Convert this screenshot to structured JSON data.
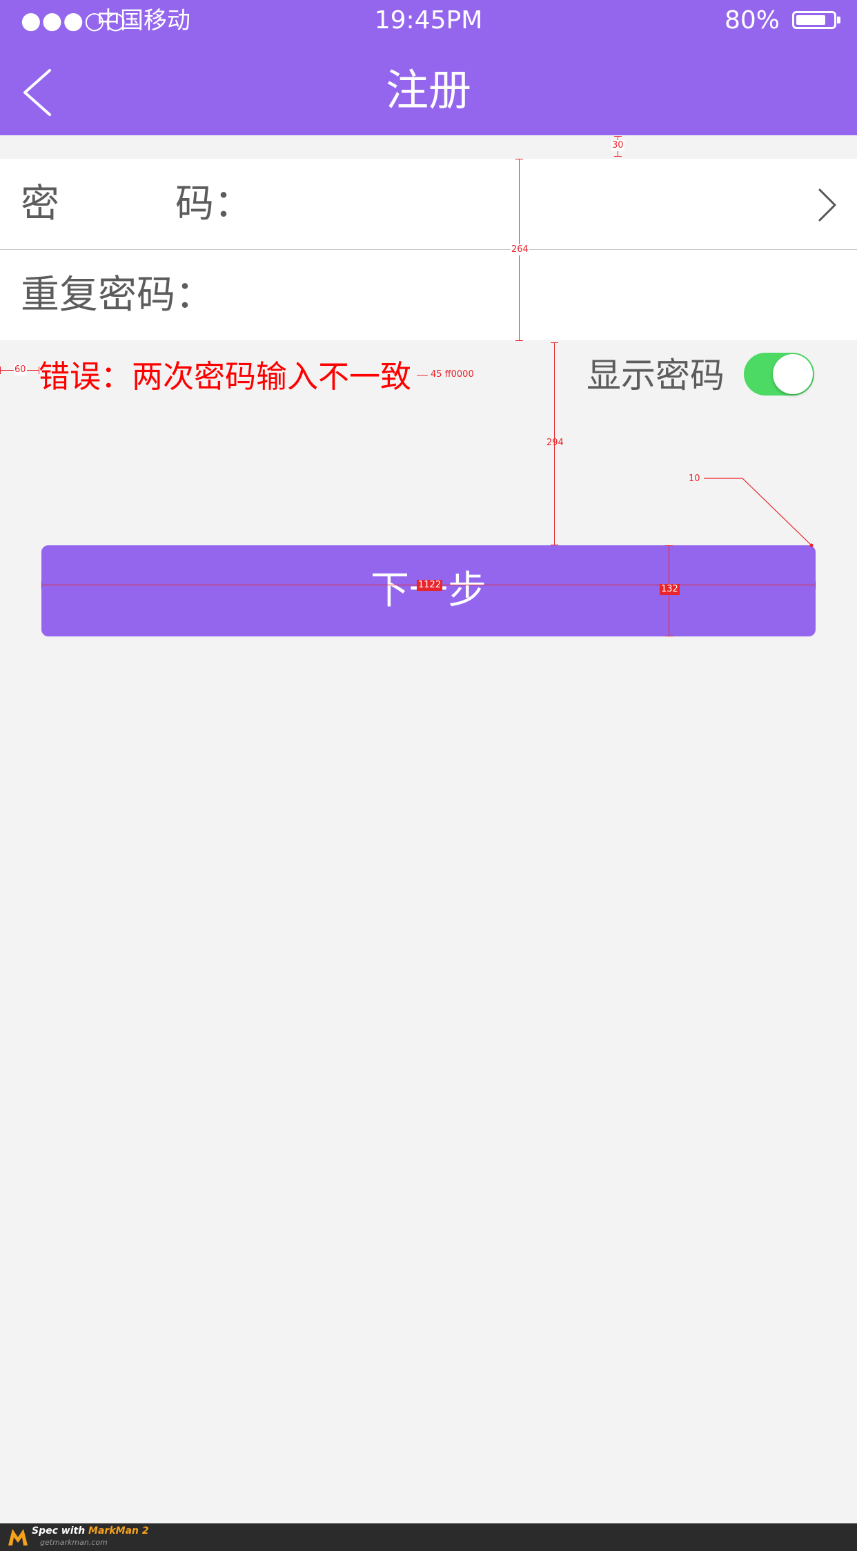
{
  "status_bar": {
    "signal": "●●●○○",
    "carrier": "中国移动",
    "time": "19:45PM",
    "battery": "80%",
    "battery_level": 0.8
  },
  "nav": {
    "title": "注册"
  },
  "form": {
    "password_label": "密　　　码：",
    "repeat_label": "重复密码："
  },
  "error": {
    "text": "错误：两次密码输入不一致"
  },
  "show_password": {
    "label": "显示密码",
    "on": true
  },
  "next_button": {
    "label": "下一步"
  },
  "annotations": {
    "top_gap": "30",
    "rows_height": "264",
    "left_margin": "60",
    "error_spec": "45  ff0000",
    "button_gap": "294",
    "corner_radius": "10",
    "button_width": "1122",
    "button_height": "132"
  },
  "footer": {
    "spec_with": "Spec with ",
    "brand": "MarkMan 2",
    "url": "getmarkman.com"
  },
  "colors": {
    "primary": "#9466ee",
    "error": "#ff0000",
    "toggle_on": "#4cd964",
    "background": "#f3f3f3"
  }
}
